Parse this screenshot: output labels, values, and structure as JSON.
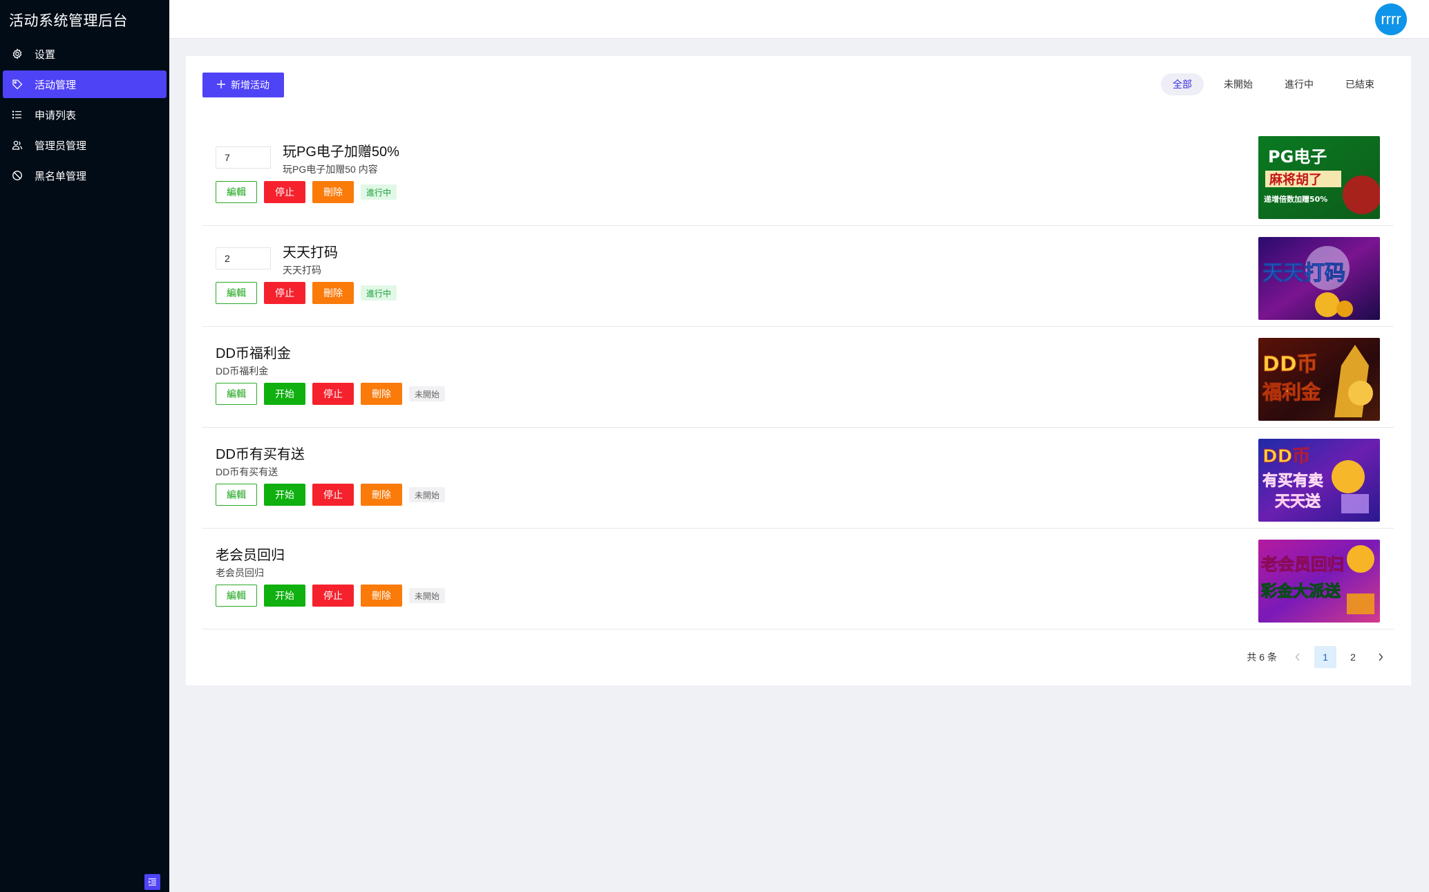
{
  "app": {
    "title": "活动系统管理后台"
  },
  "sidebar": {
    "items": [
      {
        "label": "设置",
        "icon": "gear-icon"
      },
      {
        "label": "活动管理",
        "icon": "tag-icon",
        "active": true
      },
      {
        "label": "申请列表",
        "icon": "list-icon"
      },
      {
        "label": "管理员管理",
        "icon": "users-icon"
      },
      {
        "label": "黑名单管理",
        "icon": "ban-icon"
      }
    ]
  },
  "header": {
    "avatar_text": "rrrr"
  },
  "toolbar": {
    "add_label": "新增活动",
    "filters": [
      "全部",
      "未開始",
      "進行中",
      "已結束"
    ],
    "active_filter": "全部"
  },
  "actions": {
    "edit": "編輯",
    "start": "开始",
    "stop": "停止",
    "delete": "刪除"
  },
  "activities": [
    {
      "order": "7",
      "title": "玩PG电子加赠50%",
      "desc": "玩PG电子加赠50 内容",
      "status": "進行中",
      "banner_lines": [
        "PG电子",
        "麻将胡了",
        "递增倍数加赠50%"
      ]
    },
    {
      "order": "2",
      "title": "天天打码",
      "desc": "天天打码",
      "status": "進行中",
      "banner_lines": [
        "天天打码"
      ]
    },
    {
      "title": "DD币福利金",
      "desc": "DD币福利金",
      "status": "未開始",
      "banner_lines": [
        "DD币",
        "福利金"
      ]
    },
    {
      "title": "DD币有买有送",
      "desc": "DD币有买有送",
      "status": "未開始",
      "banner_lines": [
        "DD币",
        "有买有卖",
        "天天送"
      ]
    },
    {
      "title": "老会员回归",
      "desc": "老会员回归",
      "status": "未開始",
      "banner_lines": [
        "老会员回归",
        "彩金大派送"
      ]
    }
  ],
  "pagination": {
    "total_text": "共 6 条",
    "pages": [
      "1",
      "2"
    ],
    "current": "1"
  },
  "colors": {
    "sidebar_bg": "#020c17",
    "accent": "#4f43f6",
    "edit_green": "#29a829",
    "start_green": "#0fb00f",
    "stop_red": "#f5222d",
    "delete_orange": "#fa7a0a",
    "avatar_blue": "#0e94e8"
  }
}
